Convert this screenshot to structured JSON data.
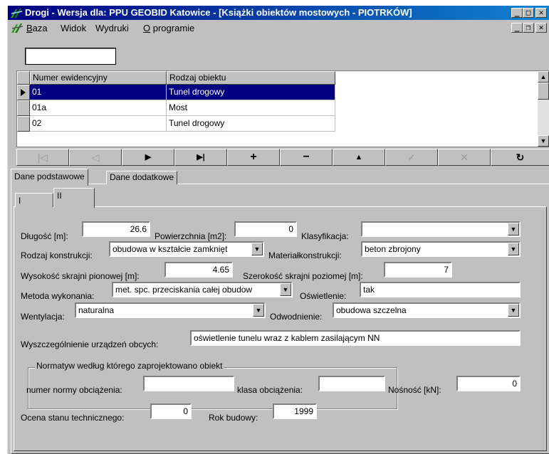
{
  "window": {
    "title_main": "Drogi - Wersja dla: PPU GEOBID Katowice - ",
    "title_doc": "[Książki obiektów mostowych - PIOTRKÓW]",
    "buttons": {
      "minimize": "_",
      "maximize": "□",
      "close": "✕",
      "restore": "❐"
    }
  },
  "menu": {
    "items": [
      {
        "underline": "B",
        "rest": "aza"
      },
      {
        "underline": "",
        "rest": "Widok"
      },
      {
        "underline": "",
        "rest": "Wydruki"
      },
      {
        "underline": "O",
        "rest": " programie"
      }
    ]
  },
  "search": {
    "value": ""
  },
  "grid": {
    "columns": [
      "Numer ewidencyjny",
      "Rodzaj obiektu"
    ],
    "rows": [
      {
        "numer": "01",
        "rodzaj": "Tunel drogowy",
        "selected": true
      },
      {
        "numer": "01a",
        "rodzaj": "Most",
        "selected": false
      },
      {
        "numer": "02",
        "rodzaj": "Tunel drogowy",
        "selected": false
      }
    ]
  },
  "navigator": {
    "first": "|◁",
    "prior": "◁",
    "next": "▶",
    "last": "▶|",
    "insert": "+",
    "delete": "−",
    "edit": "▲",
    "post": "✓",
    "cancel": "✕",
    "refresh": "↻"
  },
  "tabs": {
    "main": [
      "Dane podstawowe",
      "Dane dodatkowe"
    ],
    "sub": [
      "I",
      "II"
    ]
  },
  "form": {
    "dlugosc": {
      "label": "Długość [m]:",
      "value": "26.6"
    },
    "powierzchnia": {
      "label": "Powierzchnia [m2]:",
      "value": "0"
    },
    "klasyfikacja": {
      "label": "Klasyfikacja:",
      "value": ""
    },
    "rodzaj_konstrukcji": {
      "label": "Rodzaj konstrukcji:",
      "value": "obudowa w kształcie zamknięt"
    },
    "material": {
      "label": "Materiałkonstrukcji:",
      "value": "beton zbrojony"
    },
    "wys_skrajni": {
      "label": "Wysokość skrajni pionowej [m]:",
      "value": "4.65"
    },
    "szer_skrajni": {
      "label": "Szerokość skrajni poziomej [m]:",
      "value": "7"
    },
    "metoda": {
      "label": "Metoda wykonania:",
      "value": "met. spc. przeciskania całej obudow"
    },
    "oswietlenie": {
      "label": "Oświetlenie:",
      "value": "tak"
    },
    "wentylacja": {
      "label": "Wentylacja:",
      "value": "naturalna"
    },
    "odwodnienie": {
      "label": "Odwodnienie:",
      "value": "obudowa szczelna"
    },
    "urzadzenia": {
      "label": "Wyszczególnienie urządzeń obcych:",
      "value": "oświetlenie tunelu wraz z kablem zasilającym NN"
    },
    "normatyw": {
      "title": "Normatyw według którego zaprojektowano obiekt"
    },
    "norma": {
      "label": "numer normy obciążenia:",
      "value": ""
    },
    "klasa": {
      "label": "klasa obciążenia:",
      "value": ""
    },
    "nosnosc": {
      "label": "Nośność [kN]:",
      "value": "0"
    },
    "ocena": {
      "label": "Ocena stanu technicznego:",
      "value": "0"
    },
    "rok": {
      "label": "Rok budowy:",
      "value": "1999"
    }
  }
}
